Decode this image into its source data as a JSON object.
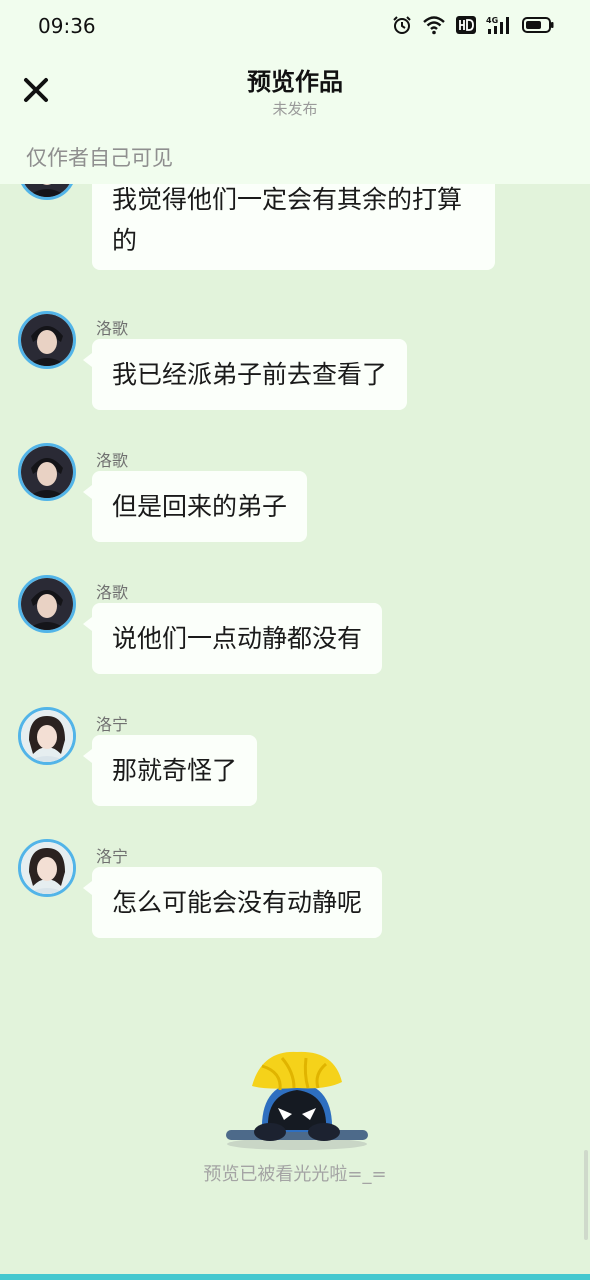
{
  "status_bar": {
    "time": "09:36"
  },
  "header": {
    "title": "预览作品",
    "subtitle": "未发布",
    "visibility_note": "仅作者自己可见"
  },
  "messages": [
    {
      "sender": "",
      "text": "我觉得他们一定会有其余的打算的"
    },
    {
      "sender": "洛歌",
      "text": "我已经派弟子前去查看了"
    },
    {
      "sender": "洛歌",
      "text": "但是回来的弟子"
    },
    {
      "sender": "洛歌",
      "text": "说他们一点动静都没有"
    },
    {
      "sender": "洛宁",
      "text": "那就奇怪了"
    },
    {
      "sender": "洛宁",
      "text": "怎么可能会没有动静呢"
    }
  ],
  "footer": {
    "end_text": "预览已被看光光啦=_="
  },
  "colors": {
    "background": "#e2f3db",
    "header_background": "#f1fdee",
    "bubble": "#fbfffa",
    "avatar_ring": "#52b4e8",
    "bottom_strip": "#44c7cf"
  }
}
